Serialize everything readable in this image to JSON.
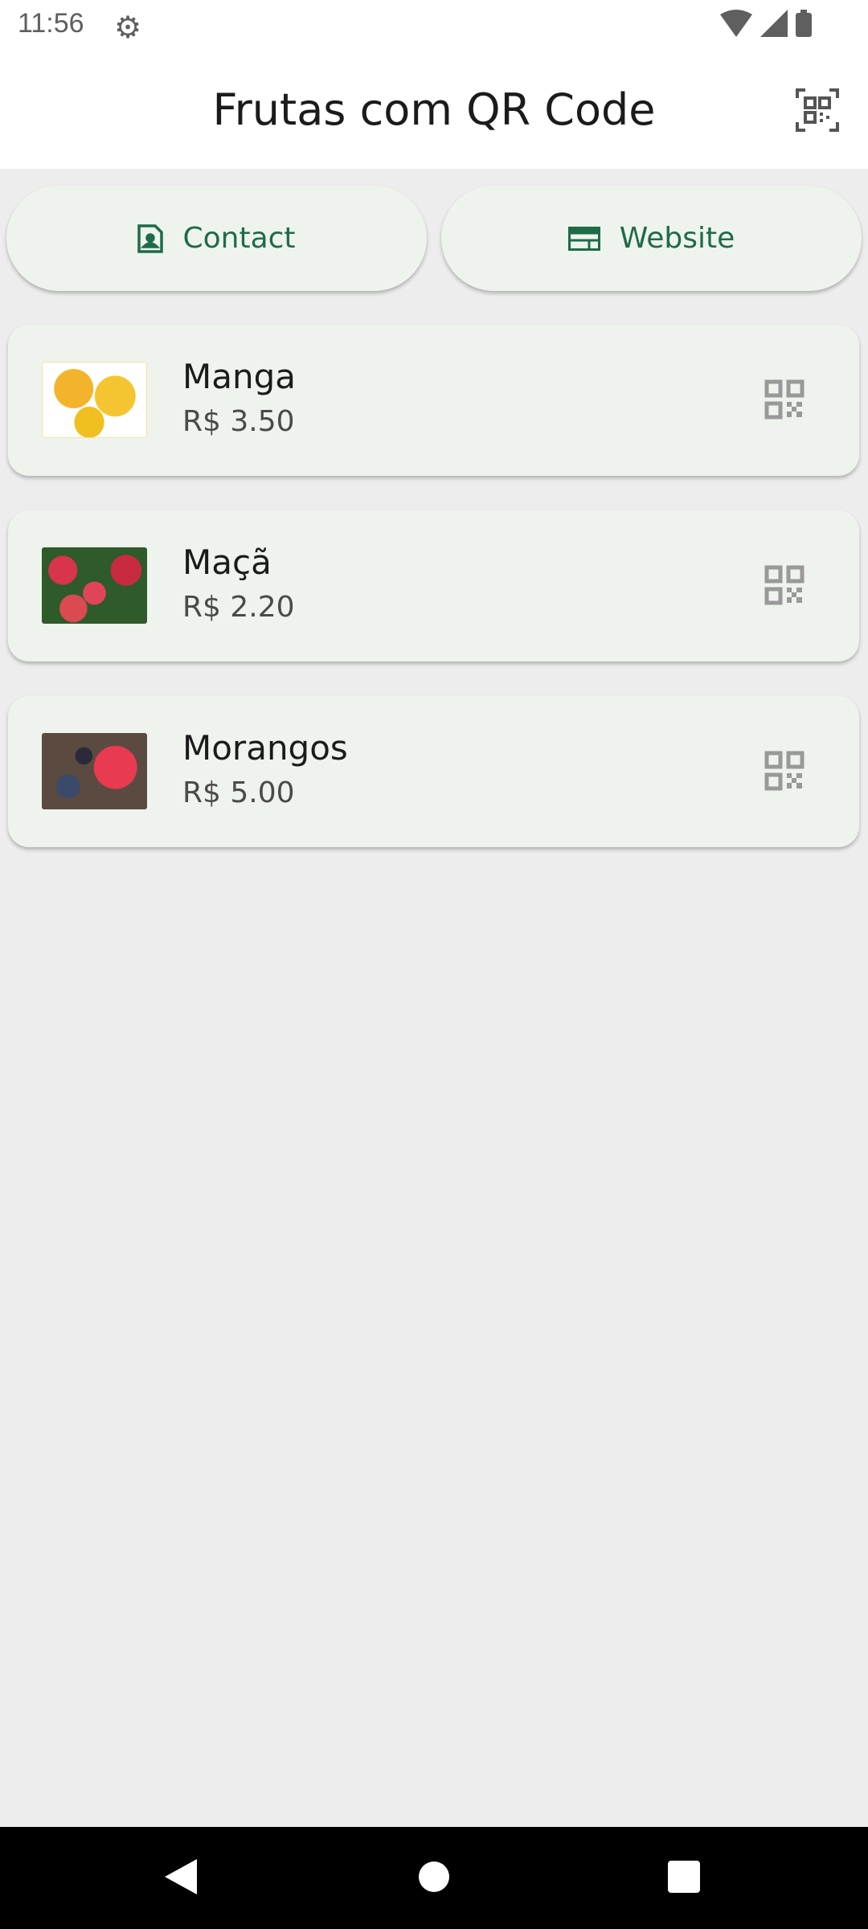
{
  "status_bar": {
    "time": "11:56",
    "icons": [
      "gear-icon",
      "wifi-icon",
      "signal-icon",
      "battery-icon"
    ]
  },
  "app_bar": {
    "title": "Frutas com QR Code",
    "action_icon": "qr-scan-icon"
  },
  "buttons": {
    "contact": "Contact",
    "website": "Website"
  },
  "colors": {
    "accent": "#1e6b48",
    "card": "#eff3ed",
    "background": "#ededed"
  },
  "fruits": [
    {
      "name": "Manga",
      "price": "R$ 3.50"
    },
    {
      "name": "Maçã",
      "price": "R$ 2.20"
    },
    {
      "name": "Morangos",
      "price": "R$ 5.00"
    }
  ]
}
